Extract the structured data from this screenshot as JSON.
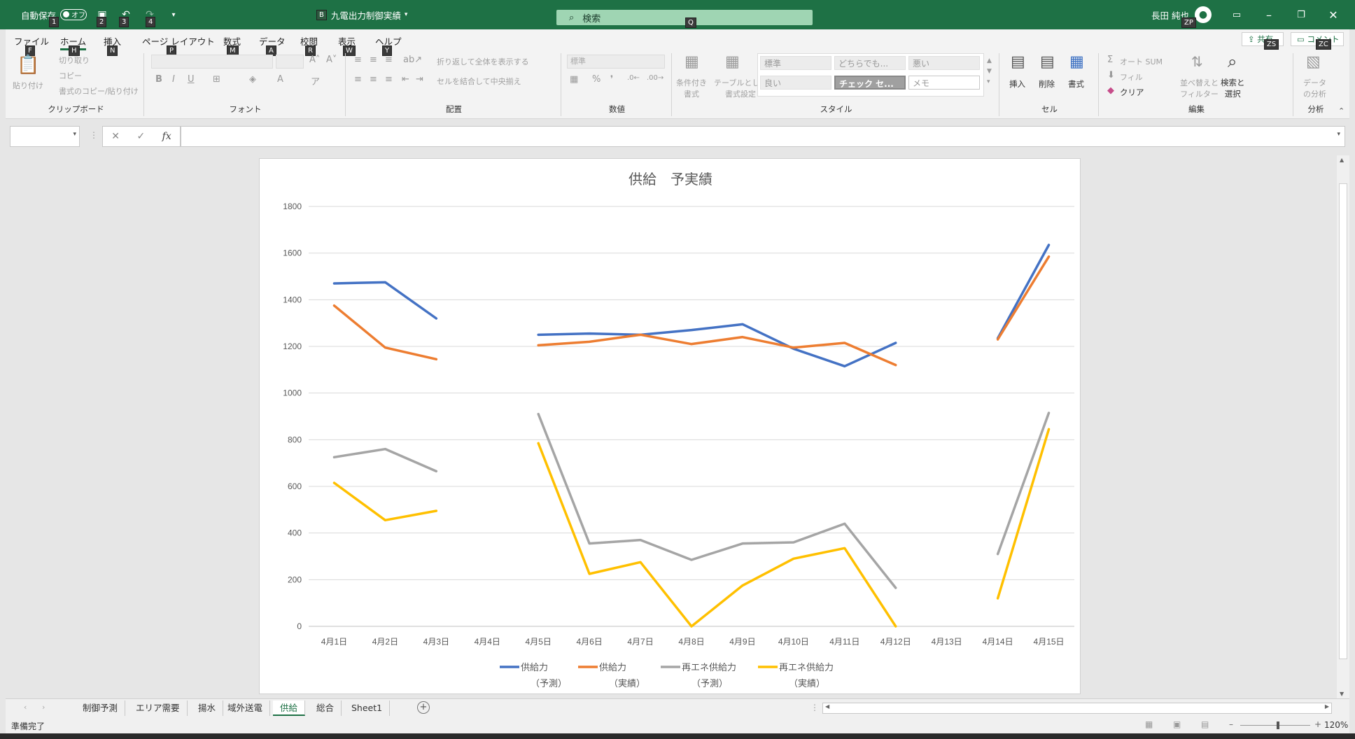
{
  "titlebar": {
    "autosave_label": "自動保存",
    "autosave_state": "オフ",
    "file_badge": "B",
    "file_name": "九電出力制御実績",
    "search_placeholder": "検索",
    "search_keytip": "Q",
    "user_name": "長田 純也",
    "user_keytip": "ZP",
    "keytips": [
      "1",
      "2",
      "3",
      "4"
    ]
  },
  "ribbon": {
    "menu": [
      {
        "label": "ファイル",
        "tip": "F"
      },
      {
        "label": "ホーム",
        "tip": "H"
      },
      {
        "label": "挿入",
        "tip": "N"
      },
      {
        "label": "ページ レイアウト",
        "tip": "P"
      },
      {
        "label": "数式",
        "tip": "M"
      },
      {
        "label": "データ",
        "tip": "A"
      },
      {
        "label": "校閲",
        "tip": "R"
      },
      {
        "label": "表示",
        "tip": "W"
      },
      {
        "label": "ヘルプ",
        "tip": "Y"
      }
    ],
    "share_label": "共有",
    "share_tip": "ZS",
    "comment_label": "コメント",
    "comment_tip": "ZC",
    "clipboard": {
      "paste": "貼り付け",
      "cut": "切り取り",
      "copy": "コピー",
      "format_painter": "書式のコピー/貼り付け",
      "label": "クリップボード"
    },
    "font": {
      "label": "フォント"
    },
    "alignment": {
      "wrap": "折り返して全体を表示する",
      "merge": "セルを結合して中央揃え",
      "label": "配置"
    },
    "number": {
      "format": "標準",
      "label": "数値"
    },
    "styles": {
      "conditional": "条件付き\n書式",
      "table": "テーブルとして\n書式設定",
      "cells": [
        "標準",
        "どちらでも...",
        "悪い",
        "良い",
        "チェック セ...",
        "メモ"
      ],
      "label": "スタイル"
    },
    "cells": {
      "insert": "挿入",
      "delete": "削除",
      "format": "書式",
      "label": "セル"
    },
    "editing": {
      "autosum": "オート SUM",
      "fill": "フィル",
      "clear": "クリア",
      "sort": "並べ替えと\nフィルター",
      "find": "検索と\n選択",
      "label": "編集"
    },
    "analysis": {
      "data": "データ\nの分析",
      "label": "分析"
    }
  },
  "formula": {
    "fx": "fx"
  },
  "chart_data": {
    "type": "line",
    "title": "供給　予実績",
    "categories": [
      "4月1日",
      "4月2日",
      "4月3日",
      "4月4日",
      "4月5日",
      "4月6日",
      "4月7日",
      "4月8日",
      "4月9日",
      "4月10日",
      "4月11日",
      "4月12日",
      "4月13日",
      "4月14日",
      "4月15日"
    ],
    "ylim": [
      0,
      1800
    ],
    "yticks": [
      0,
      200,
      400,
      600,
      800,
      1000,
      1200,
      1400,
      1600,
      1800
    ],
    "grid": true,
    "legend": "bottom",
    "series": [
      {
        "name": "供給力\n（予測）",
        "color": "#4472c4",
        "values": [
          1470,
          1475,
          1320,
          null,
          1250,
          1255,
          1250,
          1270,
          1295,
          1190,
          1115,
          1215,
          null,
          1235,
          1635
        ]
      },
      {
        "name": "供給力\n（実績）",
        "color": "#ed7d31",
        "values": [
          1375,
          1195,
          1145,
          null,
          1205,
          1220,
          1250,
          1210,
          1240,
          1195,
          1215,
          1120,
          null,
          1230,
          1585
        ]
      },
      {
        "name": "再エネ供給力\n（予測）",
        "color": "#a5a5a5",
        "values": [
          725,
          760,
          665,
          null,
          910,
          355,
          370,
          285,
          355,
          360,
          440,
          165,
          null,
          310,
          915
        ]
      },
      {
        "name": "再エネ供給力\n（実績）",
        "color": "#ffc000",
        "values": [
          615,
          455,
          495,
          null,
          785,
          225,
          275,
          0,
          175,
          290,
          335,
          0,
          null,
          120,
          845
        ]
      }
    ]
  },
  "sheets": {
    "tabs": [
      "制御予測",
      "エリア需要",
      "揚水",
      "域外送電",
      "供給",
      "総合",
      "Sheet1"
    ],
    "active": "供給"
  },
  "status": {
    "ready": "準備完了",
    "zoom": "120%"
  }
}
